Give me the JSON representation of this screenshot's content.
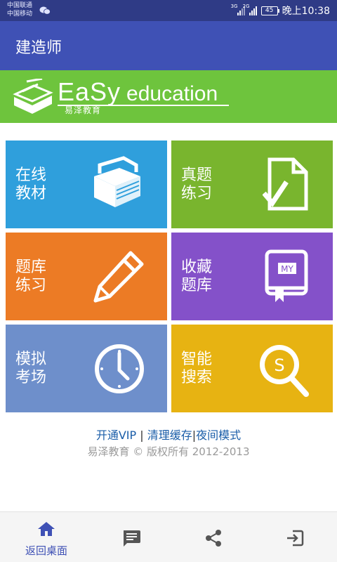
{
  "status_bar": {
    "carrier_1": "中国联通",
    "carrier_2": "中国移动",
    "net_1": "3G",
    "net_2": "2G",
    "battery": "45",
    "time": "晚上10:38"
  },
  "app_bar": {
    "title": "建造师"
  },
  "banner": {
    "brand_part_1": "EaSy",
    "brand_part_2": "education",
    "brand_cn": "易泽教育"
  },
  "tiles": [
    {
      "line1": "在线",
      "line2": "教材",
      "icon": "book-stack-icon",
      "color": "#2f9fdc"
    },
    {
      "line1": "真题",
      "line2": "练习",
      "icon": "document-check-icon",
      "color": "#79b52e"
    },
    {
      "line1": "题库",
      "line2": "练习",
      "icon": "pencil-icon",
      "color": "#ec7b25"
    },
    {
      "line1": "收藏",
      "line2": "题库",
      "icon": "bookmark-book-icon",
      "color": "#8451c9",
      "icon_text": "MY"
    },
    {
      "line1": "模拟",
      "line2": "考场",
      "icon": "clock-icon",
      "color": "#6e8fcb"
    },
    {
      "line1": "智能",
      "line2": "搜索",
      "icon": "search-s-icon",
      "color": "#e7b312",
      "icon_text": "S"
    }
  ],
  "footer": {
    "link_vip": "开通VIP",
    "link_cache": "清理缓存",
    "link_night": "夜间模式",
    "separator": "|",
    "copyright": "易泽教育 © 版权所有 2012-2013"
  },
  "bottom_nav": {
    "home_label": "返回桌面",
    "items": [
      "home-icon",
      "message-icon",
      "share-icon",
      "exit-icon"
    ]
  }
}
